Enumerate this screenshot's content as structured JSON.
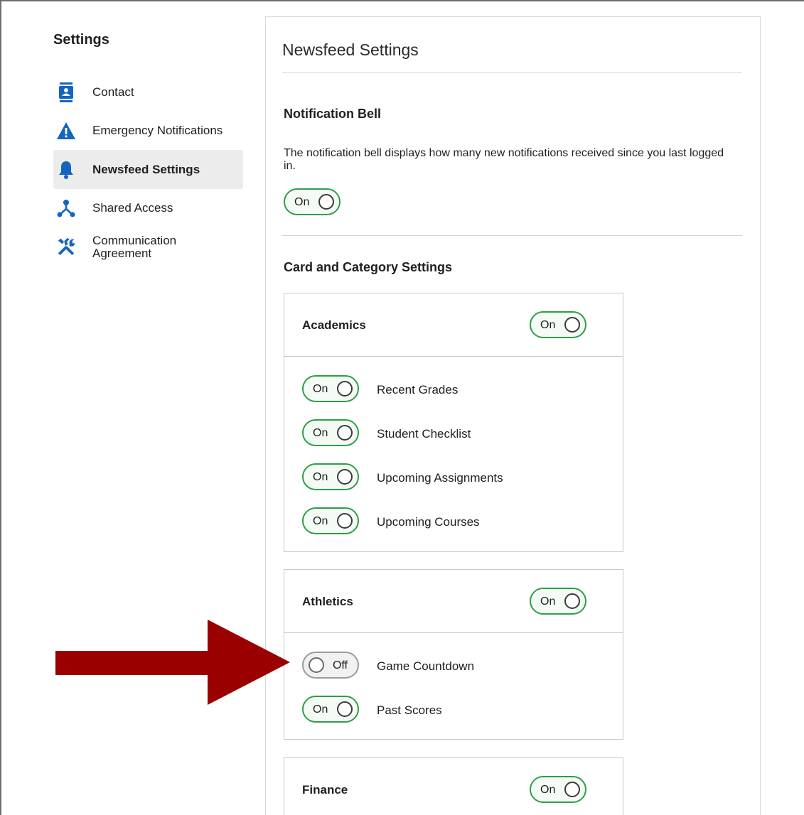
{
  "sidebar": {
    "title": "Settings",
    "items": [
      {
        "label": "Contact",
        "icon": "contact-card-icon"
      },
      {
        "label": "Emergency Notifications",
        "icon": "warning-icon"
      },
      {
        "label": "Newsfeed Settings",
        "icon": "bell-icon",
        "active": true
      },
      {
        "label": "Shared Access",
        "icon": "share-icon"
      },
      {
        "label": "Communication\nAgreement",
        "icon": "tools-icon"
      }
    ]
  },
  "main": {
    "title": "Newsfeed Settings",
    "notification_bell": {
      "title": "Notification Bell",
      "description": "The notification bell displays how many new notifications received since you last logged in.",
      "toggle": "On"
    },
    "card_category": {
      "title": "Card and Category Settings",
      "categories": [
        {
          "name": "Academics",
          "toggle": "On",
          "items": [
            {
              "label": "Recent Grades",
              "toggle": "On"
            },
            {
              "label": "Student Checklist",
              "toggle": "On"
            },
            {
              "label": "Upcoming Assignments",
              "toggle": "On"
            },
            {
              "label": "Upcoming Courses",
              "toggle": "On"
            }
          ]
        },
        {
          "name": "Athletics",
          "toggle": "On",
          "items": [
            {
              "label": "Game Countdown",
              "toggle": "Off"
            },
            {
              "label": "Past Scores",
              "toggle": "On"
            }
          ]
        },
        {
          "name": "Finance",
          "toggle": "On",
          "items": []
        }
      ]
    }
  },
  "colors": {
    "accent_blue": "#1565c0",
    "toggle_on": "#2e9e47",
    "toggle_off": "#9b9b9b",
    "arrow": "#9a0000"
  }
}
